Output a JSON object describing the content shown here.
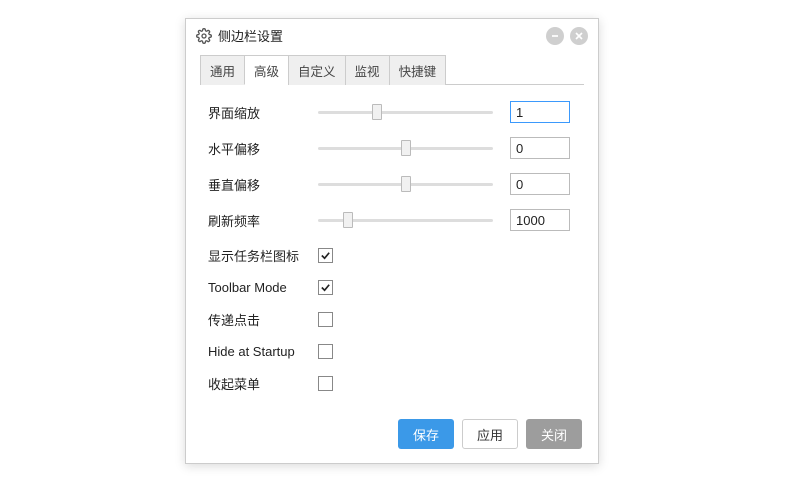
{
  "window": {
    "title": "侧边栏设置"
  },
  "tabs": [
    "通用",
    "高级",
    "自定义",
    "监视",
    "快捷键"
  ],
  "active_tab_index": 1,
  "sliders": [
    {
      "label": "界面缩放",
      "value": "1",
      "thumb_pct": 33,
      "focused": true
    },
    {
      "label": "水平偏移",
      "value": "0",
      "thumb_pct": 50,
      "focused": false
    },
    {
      "label": "垂直偏移",
      "value": "0",
      "thumb_pct": 50,
      "focused": false
    },
    {
      "label": "刷新频率",
      "value": "1000",
      "thumb_pct": 15,
      "focused": false
    }
  ],
  "checkboxes": [
    {
      "label": "显示任务栏图标",
      "checked": true
    },
    {
      "label": "Toolbar Mode",
      "checked": true
    },
    {
      "label": "传递点击",
      "checked": false
    },
    {
      "label": "Hide at Startup",
      "checked": false
    },
    {
      "label": "收起菜单",
      "checked": false
    }
  ],
  "footer": {
    "save": "保存",
    "apply": "应用",
    "close": "关闭"
  }
}
